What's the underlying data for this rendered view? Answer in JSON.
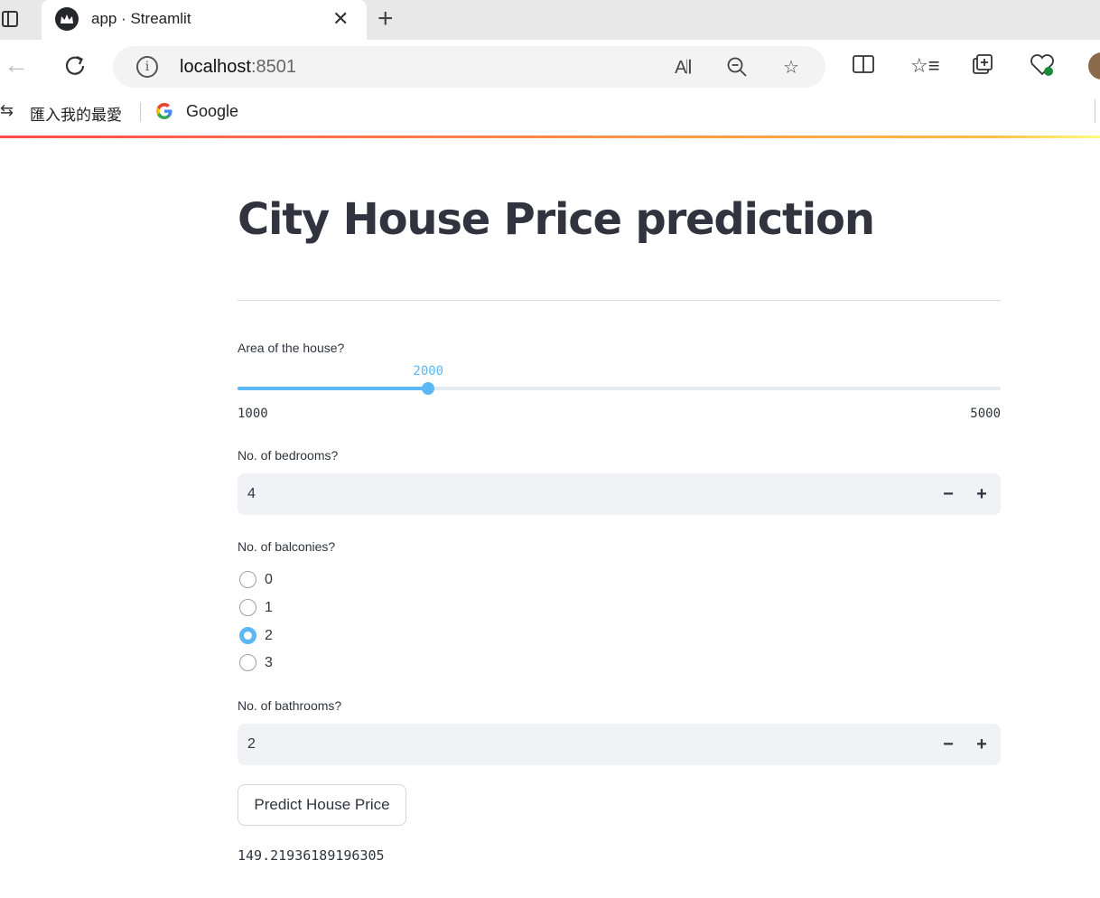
{
  "browser": {
    "tab_title": "app · Streamlit",
    "url_host": "localhost",
    "url_port": ":8501",
    "bookmarks": {
      "import_label": "匯入我的最愛",
      "google_label": "Google"
    }
  },
  "app": {
    "title": "City House Price prediction",
    "area": {
      "label": "Area of the house?",
      "min": 1000,
      "max": 5000,
      "value": 2000,
      "min_label": "1000",
      "max_label": "5000",
      "value_label": "2000"
    },
    "bedrooms": {
      "label": "No. of bedrooms?",
      "value": "4",
      "minus": "−",
      "plus": "+"
    },
    "balconies": {
      "label": "No. of balconies?",
      "options": [
        "0",
        "1",
        "2",
        "3"
      ],
      "selected": "2"
    },
    "bathrooms": {
      "label": "No. of bathrooms?",
      "value": "2",
      "minus": "−",
      "plus": "+"
    },
    "predict_button": "Predict House Price",
    "result": "149.21936189196305"
  },
  "colors": {
    "accent": "#5bb8f5",
    "text": "#31333f",
    "input_bg": "#f0f2f6"
  }
}
